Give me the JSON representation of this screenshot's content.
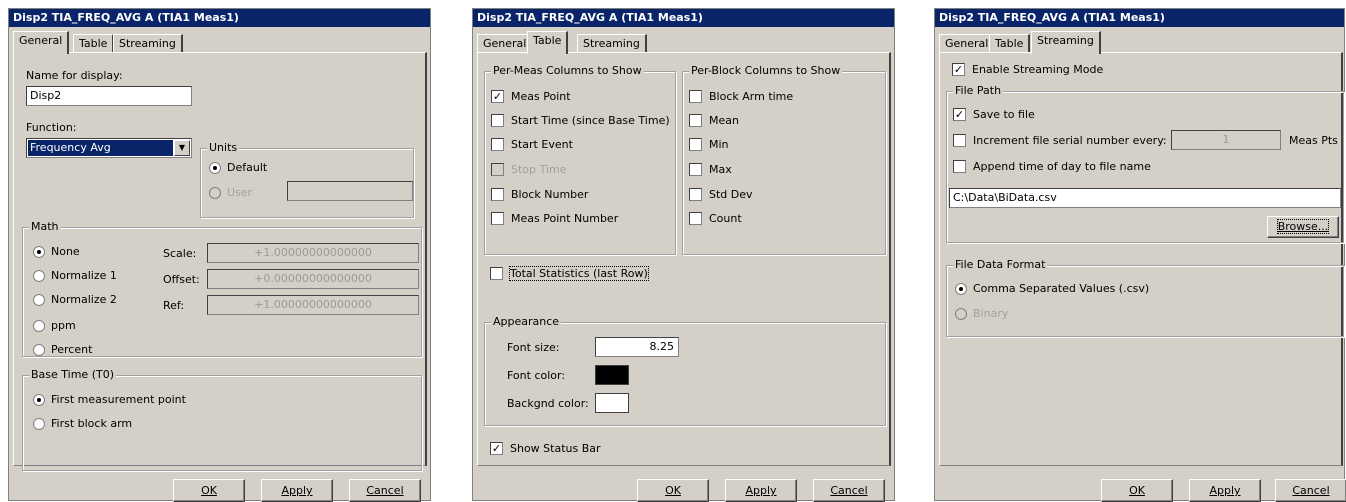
{
  "window_title": "Disp2 TIA_FREQ_AVG A (TIA1 Meas1)",
  "tabs": [
    "General",
    "Table",
    "Streaming"
  ],
  "buttons": {
    "ok": "OK",
    "apply": "Apply",
    "cancel": "Cancel",
    "browse": "Browse..."
  },
  "general": {
    "name_label": "Name for display:",
    "name_value": "Disp2",
    "function_label": "Function:",
    "function_value": "Frequency Avg",
    "units": {
      "title": "Units",
      "default": "Default",
      "user": "User",
      "selected": "Default"
    },
    "math": {
      "title": "Math",
      "options": [
        "None",
        "Normalize 1",
        "Normalize 2",
        "ppm",
        "Percent"
      ],
      "selected": "None",
      "scale_label": "Scale:",
      "scale_value": "+1.00000000000000",
      "offset_label": "Offset:",
      "offset_value": "+0.00000000000000",
      "ref_label": "Ref:",
      "ref_value": "+1.00000000000000"
    },
    "base_time": {
      "title": "Base Time (T0)",
      "options": [
        "First measurement point",
        "First block arm"
      ],
      "selected": "First measurement point"
    }
  },
  "table": {
    "per_meas": {
      "title": "Per-Meas Columns to Show",
      "items": [
        {
          "label": "Meas Point",
          "checked": true,
          "enabled": true
        },
        {
          "label": "Start Time (since Base Time)",
          "checked": false,
          "enabled": true
        },
        {
          "label": "Start Event",
          "checked": false,
          "enabled": true
        },
        {
          "label": "Stop Time",
          "checked": false,
          "enabled": false
        },
        {
          "label": "Block Number",
          "checked": false,
          "enabled": true
        },
        {
          "label": "Meas Point Number",
          "checked": false,
          "enabled": true
        }
      ]
    },
    "per_block": {
      "title": "Per-Block Columns to Show",
      "items": [
        {
          "label": "Block Arm time",
          "checked": false
        },
        {
          "label": "Mean",
          "checked": false
        },
        {
          "label": "Min",
          "checked": false
        },
        {
          "label": "Max",
          "checked": false
        },
        {
          "label": "Std Dev",
          "checked": false
        },
        {
          "label": "Count",
          "checked": false
        }
      ]
    },
    "total_stats": {
      "label": "Total Statistics (last Row)",
      "checked": false
    },
    "appearance": {
      "title": "Appearance",
      "font_size_label": "Font size:",
      "font_size_value": "8.25",
      "font_color_label": "Font color:",
      "font_color": "#000000",
      "backgnd_color_label": "Backgnd color:",
      "backgnd_color": "#ffffff"
    },
    "status_bar": {
      "label": "Show Status Bar",
      "checked": true
    }
  },
  "streaming": {
    "enable": {
      "label": "Enable Streaming Mode",
      "checked": true
    },
    "file_path": {
      "title": "File Path",
      "save": {
        "label": "Save to file",
        "checked": true
      },
      "increment": {
        "label": "Increment file serial number every:",
        "checked": false,
        "value": "1",
        "unit": "Meas Pts"
      },
      "append": {
        "label": "Append time of day to file name",
        "checked": false
      },
      "path_value": "C:\\Data\\BiData.csv"
    },
    "format": {
      "title": "File Data Format",
      "csv": "Comma Separated Values (.csv)",
      "binary": "Binary",
      "selected": "csv"
    }
  }
}
